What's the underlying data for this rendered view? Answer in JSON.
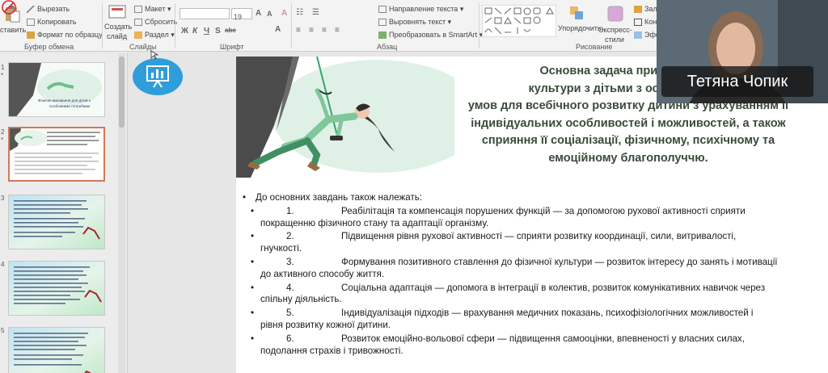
{
  "ribbon": {
    "clipboard": {
      "paste": "ставить",
      "cut": "Вырезать",
      "copy": "Копировать",
      "format_painter": "Формат по образцу",
      "label": "Буфер обмена"
    },
    "slides": {
      "new_slide_line1": "Создать",
      "new_slide_line2": "слайд",
      "layout": "Макет",
      "reset": "Сбросить",
      "section": "Раздел",
      "label": "Слайды"
    },
    "font": {
      "size": "19",
      "label": "Шрифт",
      "bold": "Ж",
      "italic": "К",
      "underline": "Ч",
      "strike": "S",
      "abc": "abc"
    },
    "paragraph": {
      "text_direction": "Направление текста",
      "align_text": "Выровнять текст",
      "smartart": "Преобразовать в SmartArt",
      "label": "Абзац"
    },
    "drawing": {
      "arrange": "Упорядочить",
      "quick_styles_line1": "Экспресс-",
      "quick_styles_line2": "стили",
      "fill": "Зал",
      "outline": "Кон",
      "effects": "Эфф",
      "label": "Рисование"
    }
  },
  "thumbnails": [
    {
      "num": "1",
      "star": "*",
      "title_line1": "Фізичне виховання для дітей з",
      "title_line2": "особливими потребами"
    },
    {
      "num": "2",
      "star": "*"
    },
    {
      "num": "3"
    },
    {
      "num": "4"
    },
    {
      "num": "5"
    }
  ],
  "slide": {
    "title_lines": [
      "Основна задача при проведен",
      "культури з дітьми з особливими п",
      "умов для всебічного розвитку дитини з урахуванням її",
      "індивідуальних особливостей і можливостей, а також",
      "сприяння її соціалізації, фізичному, психічному та",
      "емоційному благополуччю."
    ],
    "bullet_char": "•",
    "intro": "До основних завдань також належать:",
    "items": [
      {
        "num": "1.",
        "head": "Реабілітація та компенсація порушених функцій — за допомогою рухової активності сприяти",
        "rest": "покращенню фізичного стану та адаптації організму."
      },
      {
        "num": "2.",
        "head": "Підвищення рівня рухової активності — сприяти розвитку координації, сили, витривалості,",
        "rest": "гнучкості."
      },
      {
        "num": "3.",
        "head": "Формування позитивного ставлення до фізичної культури — розвиток інтересу до занять і мотивації",
        "rest": "до активного способу життя."
      },
      {
        "num": "4.",
        "head": "Соціальна адаптація — допомога в інтеграції в колектив, розвиток комунікативних навичок через",
        "rest": "спільну діяльність."
      },
      {
        "num": "5.",
        "head": "Індивідуалізація підходів — врахування медичних показань, психофізіологічних можливостей і",
        "rest": "рівня розвитку кожної дитини."
      },
      {
        "num": "6.",
        "head": "Розвиток емоційно-вольової сфери — підвищення самооцінки, впевненості у власних силах,",
        "rest": "подолання страхів і тривожності."
      }
    ]
  },
  "video": {
    "speaker_name": "Тетяна Чопик"
  },
  "colors": {
    "title_text": "#3a4a3a",
    "selected_thumb_border": "#d0795a",
    "logo_blue": "#2f9ed8",
    "figure_green": "#7fc79a"
  }
}
